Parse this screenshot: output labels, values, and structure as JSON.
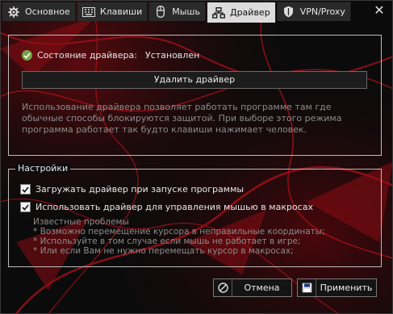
{
  "tabs": [
    {
      "label": "Основное",
      "icon": "gear-icon"
    },
    {
      "label": "Клавиши",
      "icon": "keyboard-icon"
    },
    {
      "label": "Мышь",
      "icon": "mouse-icon"
    },
    {
      "label": "Драйвер",
      "icon": "network-icon",
      "active": true
    },
    {
      "label": "VPN/Proxy",
      "icon": "shield-icon"
    }
  ],
  "close_label": "✕",
  "driver": {
    "status_label": "Состояние драйвера:",
    "status_value": "Установлен",
    "remove_button": "Удалить драйвер",
    "description": "Использование драйвера позволяет работать программе там где обычные способы блокируются защитой. При выборе этого режима программа работает так будто клавиши нажимает человек."
  },
  "settings": {
    "title": "Настройки",
    "options": [
      {
        "label": "Загружать драйвер при запуске программы",
        "checked": true
      },
      {
        "label": "Использовать драйвер для управления мышью в макросах",
        "checked": true
      }
    ],
    "notes": [
      "Известные проблемы",
      "* Возможно перемещение курсора в неправильные координаты;",
      "* Используйте в том случае если мышь не работает в игре;",
      "* Или если Вам не нужно перемещать курсор в макросах;"
    ]
  },
  "buttons": {
    "cancel": "Отмена",
    "apply": "Применить"
  },
  "colors": {
    "accent_red": "#b3101a",
    "status_ok": "#77a34a",
    "panel_border": "#bdbdbd"
  }
}
